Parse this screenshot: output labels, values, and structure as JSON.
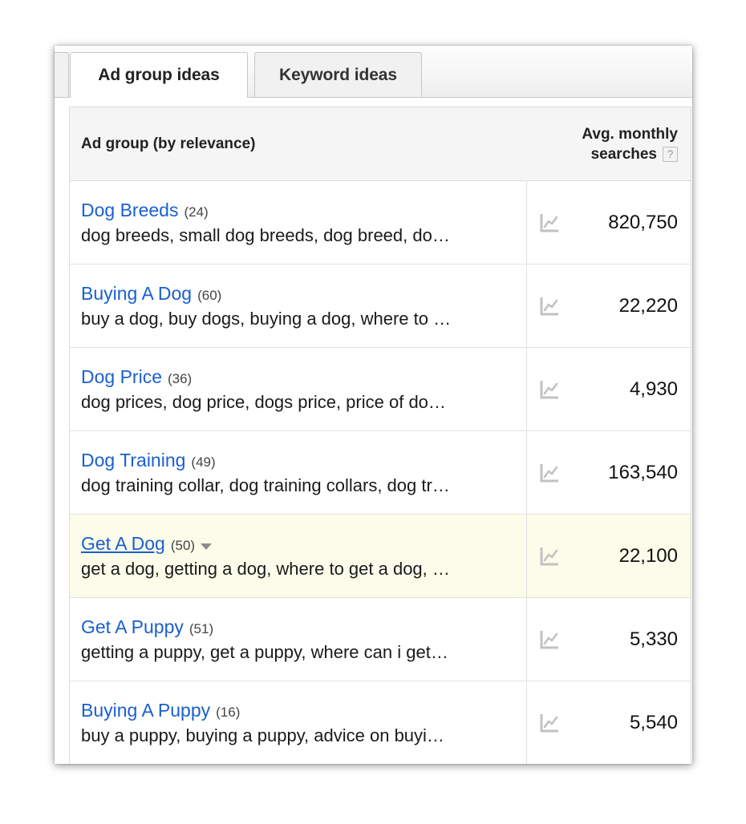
{
  "tabs": [
    {
      "label": "Ad group ideas",
      "active": true
    },
    {
      "label": "Keyword ideas",
      "active": false
    }
  ],
  "table": {
    "columns": {
      "ad_group": "Ad group (by relevance)",
      "avg_monthly_searches_line1": "Avg. monthly",
      "avg_monthly_searches_line2": "searches",
      "help_badge": "?"
    },
    "rows": [
      {
        "name": "Dog Breeds",
        "count": "(24)",
        "keywords": "dog breeds, small dog breeds, dog breed, do…",
        "searches": "820,750",
        "trend_icon": "line-chart-icon",
        "highlighted": false,
        "has_caret": false
      },
      {
        "name": "Buying A Dog",
        "count": "(60)",
        "keywords": "buy a dog, buy dogs, buying a dog, where to …",
        "searches": "22,220",
        "trend_icon": "line-chart-icon",
        "highlighted": false,
        "has_caret": false
      },
      {
        "name": "Dog Price",
        "count": "(36)",
        "keywords": "dog prices, dog price, dogs price, price of do…",
        "searches": "4,930",
        "trend_icon": "line-chart-icon",
        "highlighted": false,
        "has_caret": false
      },
      {
        "name": "Dog Training",
        "count": "(49)",
        "keywords": "dog training collar, dog training collars, dog tr…",
        "searches": "163,540",
        "trend_icon": "line-chart-icon",
        "highlighted": false,
        "has_caret": false
      },
      {
        "name": "Get A Dog",
        "count": "(50)",
        "keywords": "get a dog, getting a dog, where to get a dog, …",
        "searches": "22,100",
        "trend_icon": "line-chart-icon",
        "highlighted": true,
        "has_caret": true
      },
      {
        "name": "Get A Puppy",
        "count": "(51)",
        "keywords": "getting a puppy, get a puppy, where can i get…",
        "searches": "5,330",
        "trend_icon": "line-chart-icon",
        "highlighted": false,
        "has_caret": false
      },
      {
        "name": "Buying A Puppy",
        "count": "(16)",
        "keywords": "buy a puppy, buying a puppy, advice on buyi…",
        "searches": "5,540",
        "trend_icon": "line-chart-icon",
        "highlighted": false,
        "has_caret": false
      }
    ]
  },
  "colors": {
    "link": "#1a5fd0",
    "highlight_row": "#fcfcea",
    "header_bg": "#f5f5f5",
    "border": "#dcdcdc",
    "icon_gray": "#c0c0c0"
  }
}
